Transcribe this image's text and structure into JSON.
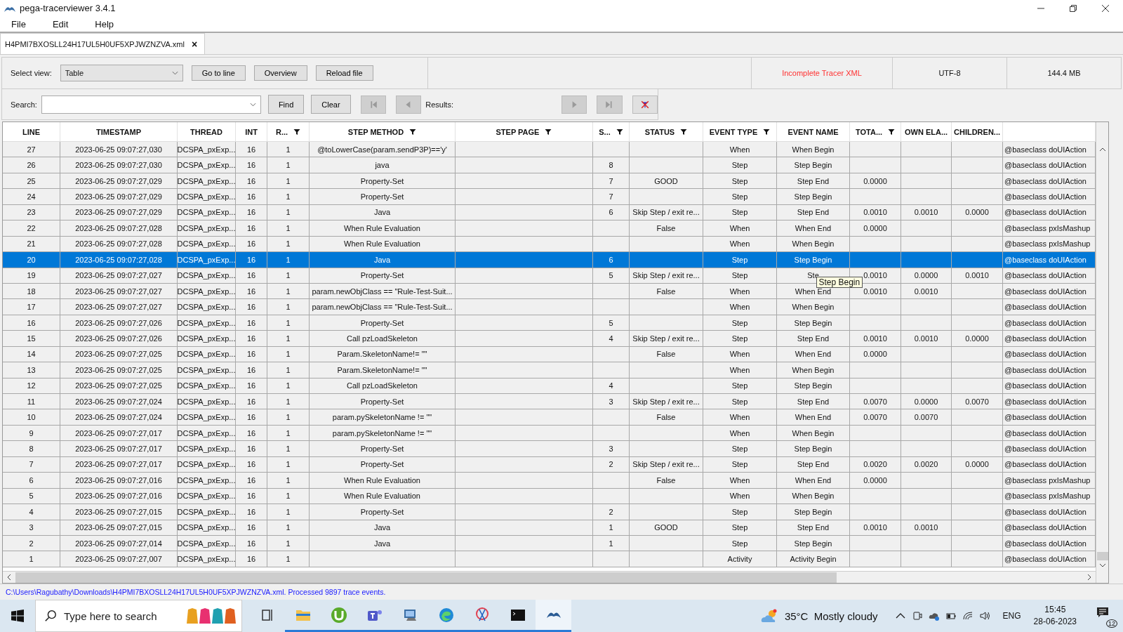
{
  "window": {
    "title": "pega-tracerviewer 3.4.1"
  },
  "menu": [
    "File",
    "Edit",
    "Help"
  ],
  "tabs": [
    {
      "label": "H4PMI7BXOSLL24H17UL5H0UF5XPJWZNZVA.xml",
      "selected": true,
      "close": "×"
    }
  ],
  "toolbar": {
    "select_label": "Select view:",
    "select_value": "Table",
    "buttons": [
      "Go to line",
      "Overview",
      "Reload file"
    ],
    "info": [
      {
        "text": "Incomplete Tracer XML",
        "kind": "warning"
      },
      {
        "text": "UTF-8",
        "kind": "plain"
      },
      {
        "text": "144.4 MB",
        "kind": "plain"
      }
    ]
  },
  "search": {
    "label": "Search:",
    "buttons": [
      "Find",
      "Clear"
    ],
    "results_label": "Results:",
    "nav": [
      {
        "kind": "first",
        "disabled": true
      },
      {
        "kind": "prev",
        "disabled": true
      },
      {
        "kind": "next",
        "disabled": true
      },
      {
        "kind": "last",
        "disabled": true
      },
      {
        "kind": "clear-filter",
        "disabled": false
      }
    ]
  },
  "table": {
    "columns": [
      {
        "label": "LINE",
        "filter": false
      },
      {
        "label": "TIMESTAMP",
        "filter": false
      },
      {
        "label": "THREAD",
        "filter": false
      },
      {
        "label": "INT",
        "filter": false
      },
      {
        "label": "R...",
        "filter": true
      },
      {
        "label": "STEP METHOD",
        "filter": true
      },
      {
        "label": "STEP PAGE",
        "filter": true
      },
      {
        "label": "S...",
        "filter": true
      },
      {
        "label": "STATUS",
        "filter": true
      },
      {
        "label": "EVENT TYPE",
        "filter": true
      },
      {
        "label": "EVENT NAME",
        "filter": false
      },
      {
        "label": "TOTA...",
        "filter": true
      },
      {
        "label": "OWN ELA...",
        "filter": false
      },
      {
        "label": "CHILDREN...",
        "filter": false
      },
      {}
    ],
    "rows": [
      {
        "cells": [
          "27",
          "2023-06-25 09:07:27,030",
          "DCSPA_pxExp...",
          "16",
          "1",
          "@toLowerCase(param.sendP3P)=='y'",
          "",
          "",
          "",
          "When",
          "When Begin",
          "",
          "",
          "",
          "@baseclass doUIAction"
        ],
        "selected": false
      },
      {
        "cells": [
          "26",
          "2023-06-25 09:07:27,030",
          "DCSPA_pxExp...",
          "16",
          "1",
          "java",
          "",
          "8",
          "",
          "Step",
          "Step Begin",
          "",
          "",
          "",
          "@baseclass doUIAction"
        ],
        "selected": false
      },
      {
        "cells": [
          "25",
          "2023-06-25 09:07:27,029",
          "DCSPA_pxExp...",
          "16",
          "1",
          "Property-Set",
          "",
          "7",
          "GOOD",
          "Step",
          "Step End",
          "0.0000",
          "",
          "",
          "@baseclass doUIAction"
        ],
        "selected": false
      },
      {
        "cells": [
          "24",
          "2023-06-25 09:07:27,029",
          "DCSPA_pxExp...",
          "16",
          "1",
          "Property-Set",
          "",
          "7",
          "",
          "Step",
          "Step Begin",
          "",
          "",
          "",
          "@baseclass doUIAction"
        ],
        "selected": false
      },
      {
        "cells": [
          "23",
          "2023-06-25 09:07:27,029",
          "DCSPA_pxExp...",
          "16",
          "1",
          "Java",
          "",
          "6",
          "Skip Step / exit re...",
          "Step",
          "Step End",
          "0.0010",
          "0.0010",
          "0.0000",
          "@baseclass doUIAction"
        ],
        "selected": false
      },
      {
        "cells": [
          "22",
          "2023-06-25 09:07:27,028",
          "DCSPA_pxExp...",
          "16",
          "1",
          "When Rule Evaluation",
          "",
          "",
          "False",
          "When",
          "When End",
          "0.0000",
          "",
          "",
          "@baseclass pxIsMashup"
        ],
        "selected": false
      },
      {
        "cells": [
          "21",
          "2023-06-25 09:07:27,028",
          "DCSPA_pxExp...",
          "16",
          "1",
          "When Rule Evaluation",
          "",
          "",
          "",
          "When",
          "When Begin",
          "",
          "",
          "",
          "@baseclass pxIsMashup"
        ],
        "selected": false
      },
      {
        "cells": [
          "20",
          "2023-06-25 09:07:27,028",
          "DCSPA_pxExp...",
          "16",
          "1",
          "Java",
          "",
          "6",
          "",
          "Step",
          "Step Begin",
          "",
          "",
          "",
          "@baseclass doUIAction"
        ],
        "selected": true
      },
      {
        "cells": [
          "19",
          "2023-06-25 09:07:27,027",
          "DCSPA_pxExp...",
          "16",
          "1",
          "Property-Set",
          "",
          "5",
          "Skip Step / exit re...",
          "Step",
          "Ste",
          "0.0010",
          "0.0000",
          "0.0010",
          "@baseclass doUIAction"
        ],
        "selected": false,
        "tooltip": "Step Begin"
      },
      {
        "cells": [
          "18",
          "2023-06-25 09:07:27,027",
          "DCSPA_pxExp...",
          "16",
          "1",
          "param.newObjClass == \"Rule-Test-Suit...",
          "",
          "",
          "False",
          "When",
          "When End",
          "0.0010",
          "0.0010",
          "",
          "@baseclass doUIAction"
        ],
        "selected": false
      },
      {
        "cells": [
          "17",
          "2023-06-25 09:07:27,027",
          "DCSPA_pxExp...",
          "16",
          "1",
          "param.newObjClass == \"Rule-Test-Suit...",
          "",
          "",
          "",
          "When",
          "When Begin",
          "",
          "",
          "",
          "@baseclass doUIAction"
        ],
        "selected": false
      },
      {
        "cells": [
          "16",
          "2023-06-25 09:07:27,026",
          "DCSPA_pxExp...",
          "16",
          "1",
          "Property-Set",
          "",
          "5",
          "",
          "Step",
          "Step Begin",
          "",
          "",
          "",
          "@baseclass doUIAction"
        ],
        "selected": false
      },
      {
        "cells": [
          "15",
          "2023-06-25 09:07:27,026",
          "DCSPA_pxExp...",
          "16",
          "1",
          "Call pzLoadSkeleton",
          "",
          "4",
          "Skip Step / exit re...",
          "Step",
          "Step End",
          "0.0010",
          "0.0010",
          "0.0000",
          "@baseclass doUIAction"
        ],
        "selected": false
      },
      {
        "cells": [
          "14",
          "2023-06-25 09:07:27,025",
          "DCSPA_pxExp...",
          "16",
          "1",
          "Param.SkeletonName!= \"\"",
          "",
          "",
          "False",
          "When",
          "When End",
          "0.0000",
          "",
          "",
          "@baseclass doUIAction"
        ],
        "selected": false
      },
      {
        "cells": [
          "13",
          "2023-06-25 09:07:27,025",
          "DCSPA_pxExp...",
          "16",
          "1",
          "Param.SkeletonName!= \"\"",
          "",
          "",
          "",
          "When",
          "When Begin",
          "",
          "",
          "",
          "@baseclass doUIAction"
        ],
        "selected": false
      },
      {
        "cells": [
          "12",
          "2023-06-25 09:07:27,025",
          "DCSPA_pxExp...",
          "16",
          "1",
          "Call pzLoadSkeleton",
          "",
          "4",
          "",
          "Step",
          "Step Begin",
          "",
          "",
          "",
          "@baseclass doUIAction"
        ],
        "selected": false
      },
      {
        "cells": [
          "11",
          "2023-06-25 09:07:27,024",
          "DCSPA_pxExp...",
          "16",
          "1",
          "Property-Set",
          "",
          "3",
          "Skip Step / exit re...",
          "Step",
          "Step End",
          "0.0070",
          "0.0000",
          "0.0070",
          "@baseclass doUIAction"
        ],
        "selected": false
      },
      {
        "cells": [
          "10",
          "2023-06-25 09:07:27,024",
          "DCSPA_pxExp...",
          "16",
          "1",
          "param.pySkeletonName != \"\"",
          "",
          "",
          "False",
          "When",
          "When End",
          "0.0070",
          "0.0070",
          "",
          "@baseclass doUIAction"
        ],
        "selected": false
      },
      {
        "cells": [
          "9",
          "2023-06-25 09:07:27,017",
          "DCSPA_pxExp...",
          "16",
          "1",
          "param.pySkeletonName != \"\"",
          "",
          "",
          "",
          "When",
          "When Begin",
          "",
          "",
          "",
          "@baseclass doUIAction"
        ],
        "selected": false
      },
      {
        "cells": [
          "8",
          "2023-06-25 09:07:27,017",
          "DCSPA_pxExp...",
          "16",
          "1",
          "Property-Set",
          "",
          "3",
          "",
          "Step",
          "Step Begin",
          "",
          "",
          "",
          "@baseclass doUIAction"
        ],
        "selected": false
      },
      {
        "cells": [
          "7",
          "2023-06-25 09:07:27,017",
          "DCSPA_pxExp...",
          "16",
          "1",
          "Property-Set",
          "",
          "2",
          "Skip Step / exit re...",
          "Step",
          "Step End",
          "0.0020",
          "0.0020",
          "0.0000",
          "@baseclass doUIAction"
        ],
        "selected": false
      },
      {
        "cells": [
          "6",
          "2023-06-25 09:07:27,016",
          "DCSPA_pxExp...",
          "16",
          "1",
          "When Rule Evaluation",
          "",
          "",
          "False",
          "When",
          "When End",
          "0.0000",
          "",
          "",
          "@baseclass pxIsMashup"
        ],
        "selected": false
      },
      {
        "cells": [
          "5",
          "2023-06-25 09:07:27,016",
          "DCSPA_pxExp...",
          "16",
          "1",
          "When Rule Evaluation",
          "",
          "",
          "",
          "When",
          "When Begin",
          "",
          "",
          "",
          "@baseclass pxIsMashup"
        ],
        "selected": false
      },
      {
        "cells": [
          "4",
          "2023-06-25 09:07:27,015",
          "DCSPA_pxExp...",
          "16",
          "1",
          "Property-Set",
          "",
          "2",
          "",
          "Step",
          "Step Begin",
          "",
          "",
          "",
          "@baseclass doUIAction"
        ],
        "selected": false
      },
      {
        "cells": [
          "3",
          "2023-06-25 09:07:27,015",
          "DCSPA_pxExp...",
          "16",
          "1",
          "Java",
          "",
          "1",
          "GOOD",
          "Step",
          "Step End",
          "0.0010",
          "0.0010",
          "",
          "@baseclass doUIAction"
        ],
        "selected": false
      },
      {
        "cells": [
          "2",
          "2023-06-25 09:07:27,014",
          "DCSPA_pxExp...",
          "16",
          "1",
          "Java",
          "",
          "1",
          "",
          "Step",
          "Step Begin",
          "",
          "",
          "",
          "@baseclass doUIAction"
        ],
        "selected": false
      },
      {
        "cells": [
          "1",
          "2023-06-25 09:07:27,007",
          "DCSPA_pxExp...",
          "16",
          "1",
          "",
          "",
          "",
          "",
          "Activity",
          "Activity Begin",
          "",
          "",
          "",
          "@baseclass doUIAction"
        ],
        "selected": false
      }
    ]
  },
  "status_bar": "C:\\Users\\Ragubathy\\Downloads\\H4PMI7BXOSLL24H17UL5H0UF5XPJWZNZVA.xml. Processed 9897 trace events.",
  "taskbar": {
    "search_placeholder": "Type here to search",
    "apps": [
      {
        "kind": "task-view",
        "running": false,
        "active": false
      },
      {
        "kind": "folder",
        "running": true,
        "active": false
      },
      {
        "kind": "torrent",
        "running": true,
        "active": false
      },
      {
        "kind": "teams",
        "running": true,
        "active": false
      },
      {
        "kind": "computer",
        "running": true,
        "active": false
      },
      {
        "kind": "edge",
        "running": true,
        "active": false
      },
      {
        "kind": "snip",
        "running": true,
        "active": false
      },
      {
        "kind": "terminal",
        "running": true,
        "active": false
      },
      {
        "kind": "tracer",
        "running": true,
        "active": true
      }
    ],
    "weather": "35°C  Mostly cloudy",
    "language": "ENG",
    "time": "15:45",
    "date": "28-06-2023",
    "notifications": "12"
  }
}
